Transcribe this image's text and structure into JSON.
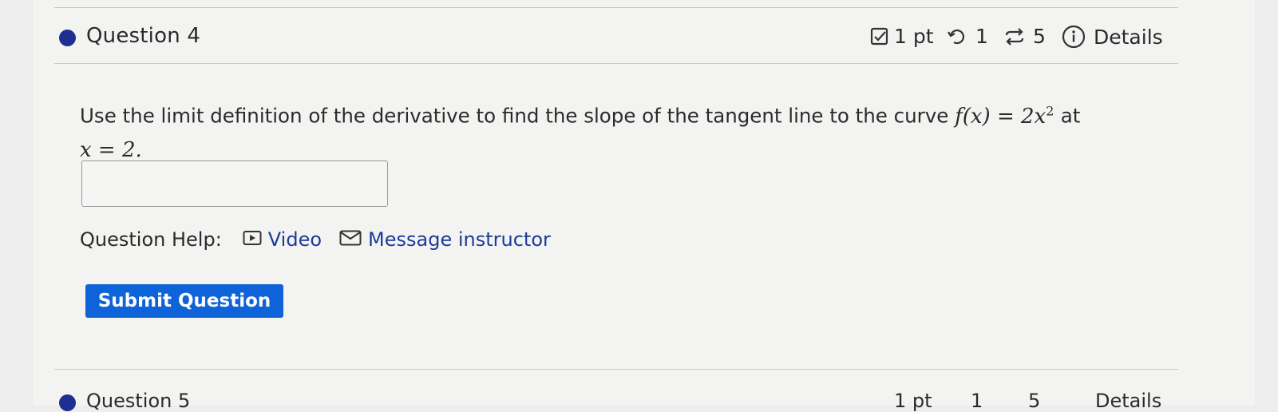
{
  "question": {
    "title": "Question 4",
    "points": "1 pt",
    "retries": "1",
    "attempts": "5",
    "details": "Details"
  },
  "prompt": {
    "text": "Use the limit definition of the derivative to find the slope of the tangent line to the curve",
    "function_lhs": "f(x)",
    "equals": "=",
    "function_rhs_coef": "2x",
    "exponent": "2",
    "at": "at",
    "point": "x = 2."
  },
  "answer": {
    "value": ""
  },
  "help": {
    "label": "Question Help:",
    "video": "Video",
    "message": "Message instructor"
  },
  "submit": {
    "label": "Submit Question"
  },
  "next_question": {
    "title": "Question 5",
    "points": "1 pt",
    "retries": "1",
    "attempts": "5",
    "details": "Details"
  },
  "colors": {
    "accent": "#1f2f8f",
    "link": "#1e3a9a",
    "button": "#0e63d8"
  }
}
